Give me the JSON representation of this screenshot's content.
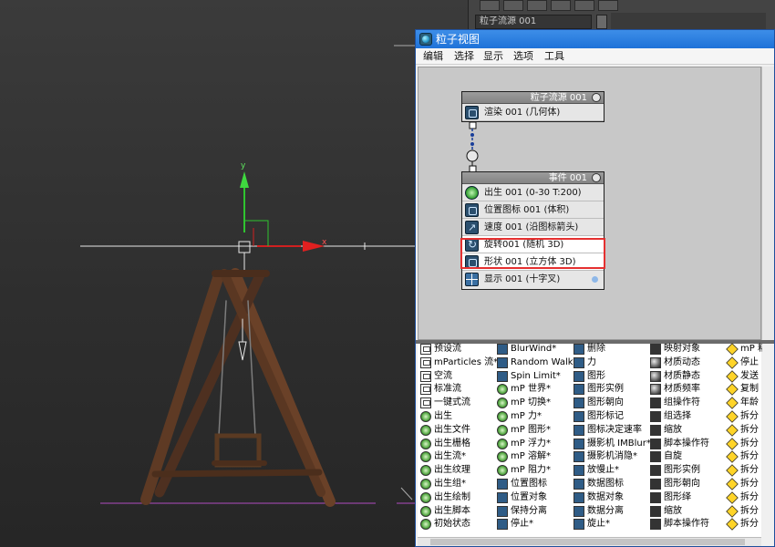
{
  "command_panel": {
    "dropdown_value": "粒子流源 001"
  },
  "viewport": {
    "axis_y": "y",
    "axis_x": "x"
  },
  "particle_view": {
    "title": "粒子视图",
    "menu": [
      "编辑",
      "选择",
      "显示",
      "选项",
      "工具"
    ],
    "source_node": {
      "header": "粒子流源 001",
      "operators": [
        {
          "label": "渲染 001 (几何体)",
          "icon": "render-icon"
        }
      ]
    },
    "event_node": {
      "header": "事件 001",
      "operators": [
        {
          "label": "出生 001 (0-30 T:200)",
          "icon": "birth-icon"
        },
        {
          "label": "位置图标 001 (体积)",
          "icon": "position-icon-icon"
        },
        {
          "label": "速度 001 (沿图标箭头)",
          "icon": "speed-icon"
        },
        {
          "label": "旋转001 (随机 3D)",
          "icon": "rotation-icon",
          "highlighted": true
        },
        {
          "label": "形状 001 (立方体 3D)",
          "icon": "shape-icon",
          "highlighted": true
        },
        {
          "label": "显示 001 (十字叉)",
          "icon": "display-icon"
        }
      ]
    },
    "depot": {
      "col1": [
        "预设流",
        "mParticles 流*",
        "空流",
        "标准流",
        "一键式流",
        "出生",
        "出生文件",
        "出生栅格",
        "出生流*",
        "出生纹理",
        "出生组*",
        "出生绘制",
        "出生脚本",
        "初始状态"
      ],
      "col2": [
        "BlurWind*",
        "Random Walk*",
        "Spin Limit*",
        "mP 世界*",
        "mP 切换*",
        "mP 力*",
        "mP 图形*",
        "mP 浮力*",
        "mP 溶解*",
        "mP 阻力*",
        "位置图标",
        "位置对象",
        "保持分离",
        "停止*"
      ],
      "col3": [
        "删除",
        "力",
        "图形",
        "图形实例",
        "图形朝向",
        "图形标记",
        "图标决定速率",
        "摄影机 IMBlur*",
        "摄影机消隐*",
        "放慢止*",
        "数据图标",
        "数据对象",
        "数据分离",
        "旋止*"
      ],
      "col4": [
        "映射对象",
        "材质动态",
        "材质静态",
        "材质频率",
        "组操作符",
        "组选择",
        "缩放",
        "脚本操作符",
        "自旋",
        "图形实例",
        "图形朝向",
        "图形绎",
        "缩放",
        "脚本操作符"
      ],
      "col5": [
        "mP 粘",
        "停止",
        "发送",
        "复制",
        "年龄",
        "拆分",
        "拆分",
        "拆分",
        "拆分",
        "拆分",
        "拆分",
        "拆分",
        "拆分",
        "拆分"
      ]
    }
  }
}
